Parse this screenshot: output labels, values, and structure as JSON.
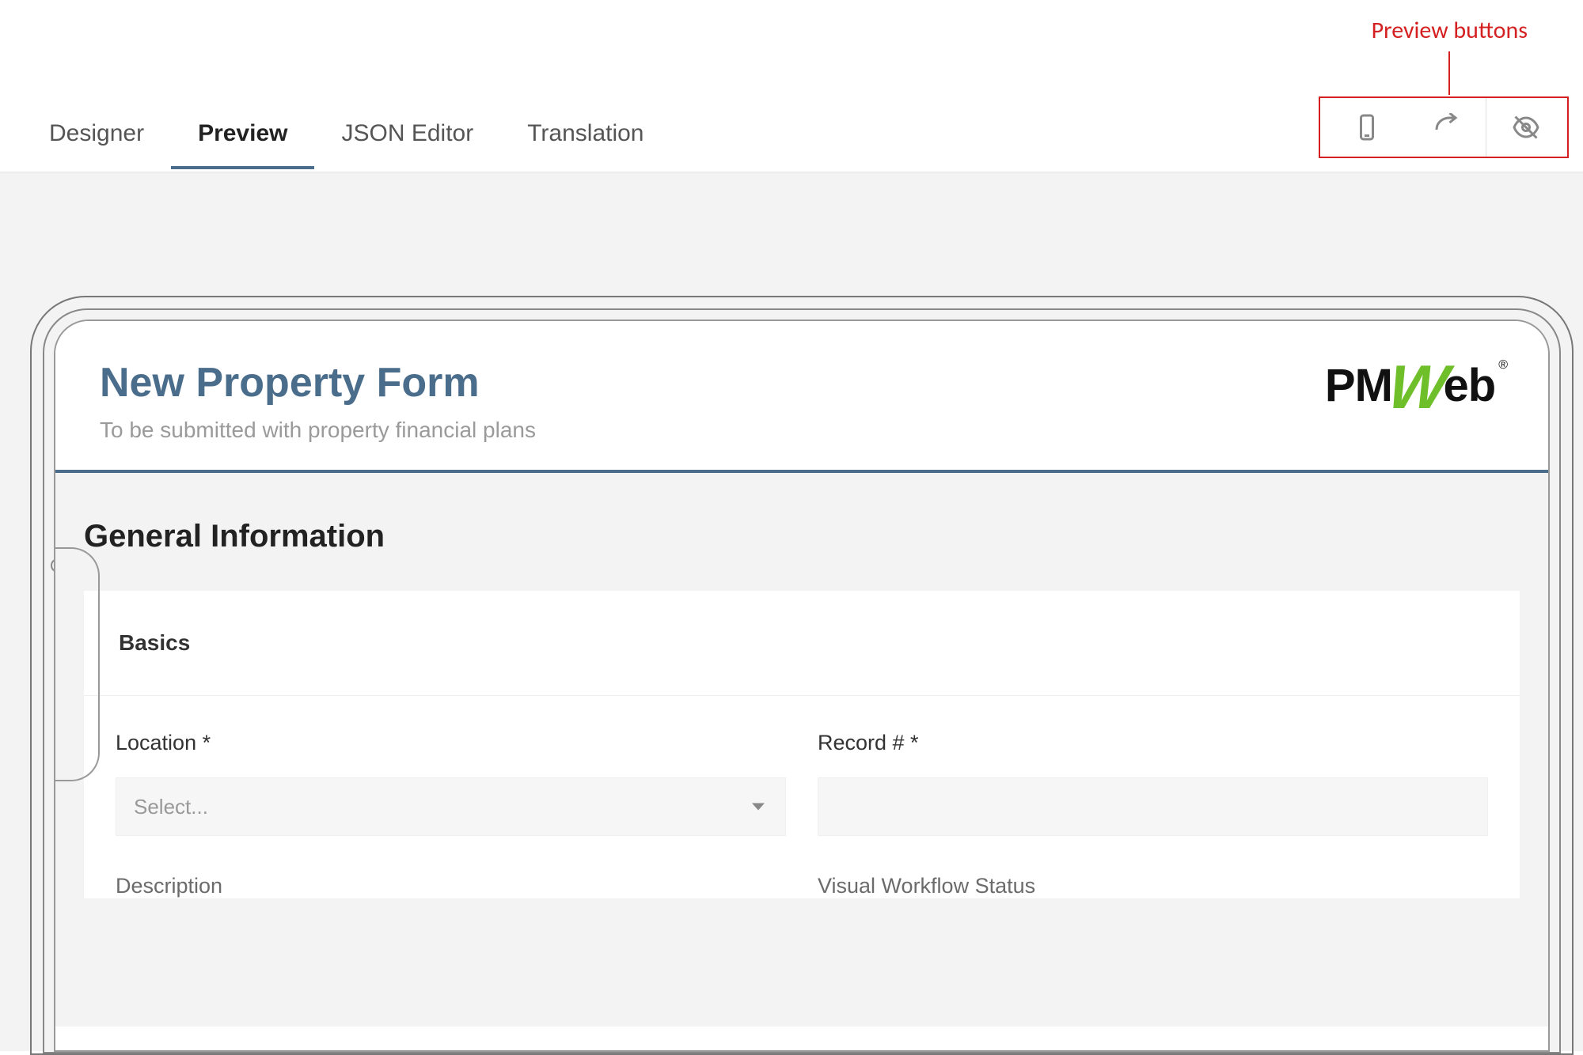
{
  "annotation": {
    "label": "Preview buttons"
  },
  "tabs": [
    {
      "label": "Designer",
      "active": false
    },
    {
      "label": "Preview",
      "active": true
    },
    {
      "label": "JSON Editor",
      "active": false
    },
    {
      "label": "Translation",
      "active": false
    }
  ],
  "toolbar": {
    "device_icon": "phone-icon",
    "orientation_icon": "rotate-arrow-icon",
    "visibility_icon": "eye-off-icon"
  },
  "logo": {
    "prefix": "PM",
    "accent": "W",
    "suffix": "eb",
    "registered": "®"
  },
  "form": {
    "title": "New Property Form",
    "subtitle": "To be submitted with property financial plans",
    "section_title": "General Information",
    "panel_header": "Basics",
    "fields": {
      "location": {
        "label": "Location *",
        "placeholder": "Select..."
      },
      "record": {
        "label": "Record # *",
        "value": ""
      },
      "description": {
        "label": "Description"
      },
      "workflow": {
        "label": "Visual Workflow Status"
      }
    }
  }
}
